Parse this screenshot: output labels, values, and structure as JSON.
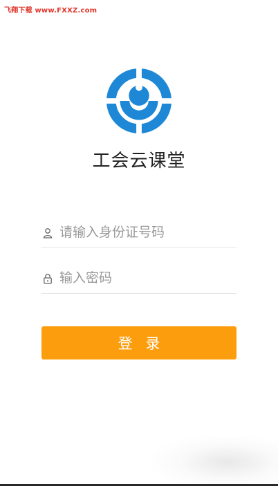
{
  "watermark": {
    "text": "飞翔下载 www.FXXZ.com"
  },
  "app": {
    "title": "工会云课堂"
  },
  "login_form": {
    "id_field": {
      "placeholder": "请输入身份证号码",
      "value": "",
      "icon": "user-icon"
    },
    "password_field": {
      "placeholder": "输入密码",
      "value": "",
      "icon": "lock-icon"
    },
    "submit_label": "登 录"
  },
  "colors": {
    "brand_blue": "#1e88d6",
    "button_orange": "#fc9d0d",
    "watermark_red": "#e0352b"
  }
}
